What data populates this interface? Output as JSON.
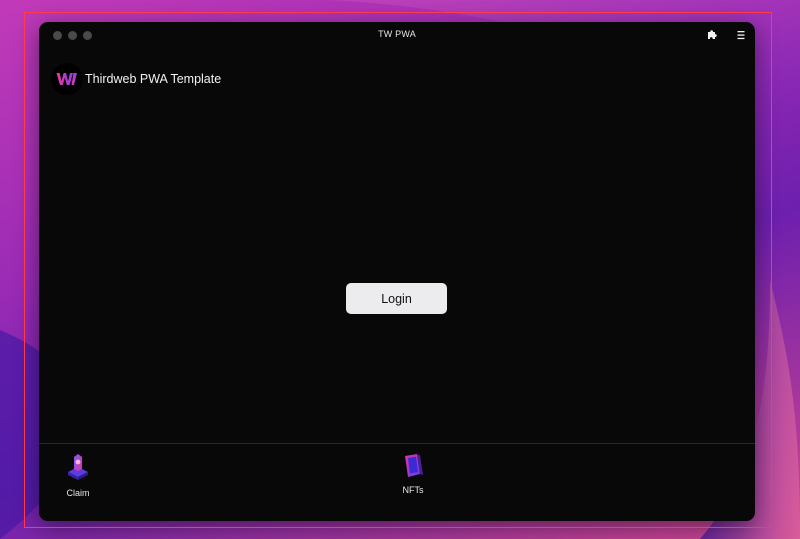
{
  "window": {
    "title": "TW PWA"
  },
  "header": {
    "app_title": "Thirdweb PWA Template",
    "logo_icon": "thirdweb-logo-icon"
  },
  "toolbar": {
    "extensions_icon": "puzzle-icon",
    "menu_icon": "hamburger-menu-icon"
  },
  "main": {
    "login_label": "Login"
  },
  "bottom_nav": {
    "items": [
      {
        "label": "Claim",
        "icon": "claim-icon"
      },
      {
        "label": "NFTs",
        "icon": "nfts-icon"
      }
    ]
  },
  "colors": {
    "window_bg": "#080808",
    "button_bg": "#ececef",
    "outline": "#ff3b4a",
    "accent_pink": "#e0339b",
    "accent_purple": "#6a3cf0"
  }
}
